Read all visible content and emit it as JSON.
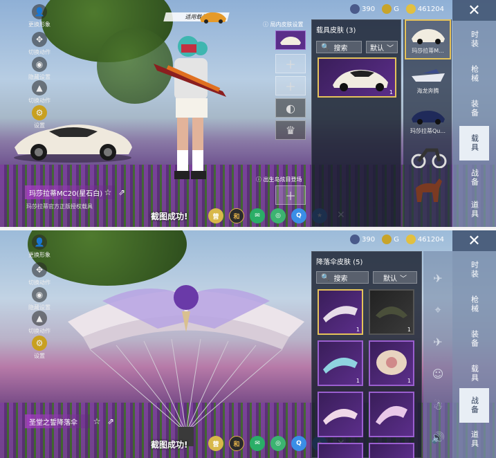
{
  "currency": {
    "gem": "390",
    "gold": "G",
    "points": "461204"
  },
  "left_menu": [
    "更换形象",
    "切换动作",
    "隐藏设置",
    "切换动作",
    "设置"
  ],
  "top": {
    "applied_vehicle": "适用载具",
    "panel_title": "载具皮肤 (3)",
    "outside_setting": "局内皮肤设置",
    "island_label": "出生岛炫目登场",
    "search_placeholder": "搜索",
    "sort": "默认",
    "item_name": "玛莎拉蒂MC20(星石白)",
    "item_desc": "玛莎拉蒂官方正版授权载具",
    "vehicles": [
      {
        "label": "玛莎拉蒂M...",
        "qty": "1"
      },
      {
        "label": "海龙奔腾",
        "qty": ""
      },
      {
        "label": "玛莎拉蒂Qu...",
        "qty": "1"
      },
      {
        "label": "",
        "qty": ""
      },
      {
        "label": "",
        "qty": ""
      }
    ],
    "selected_qty": "1"
  },
  "bottom": {
    "panel_title": "降落伞皮肤 (5)",
    "search_placeholder": "搜索",
    "sort": "默认",
    "item_name": "圣堂之誓降落伞",
    "qty": [
      "1",
      "1",
      "1",
      "1",
      "",
      ""
    ]
  },
  "nav": [
    "时装",
    "枪械",
    "装备",
    "载具",
    "战备",
    "道具"
  ],
  "screenshot_text": "截图成功!",
  "share": [
    "和平营地",
    "和平精英",
    "微信",
    "朋友圈",
    "QQ",
    "QQ空间"
  ]
}
